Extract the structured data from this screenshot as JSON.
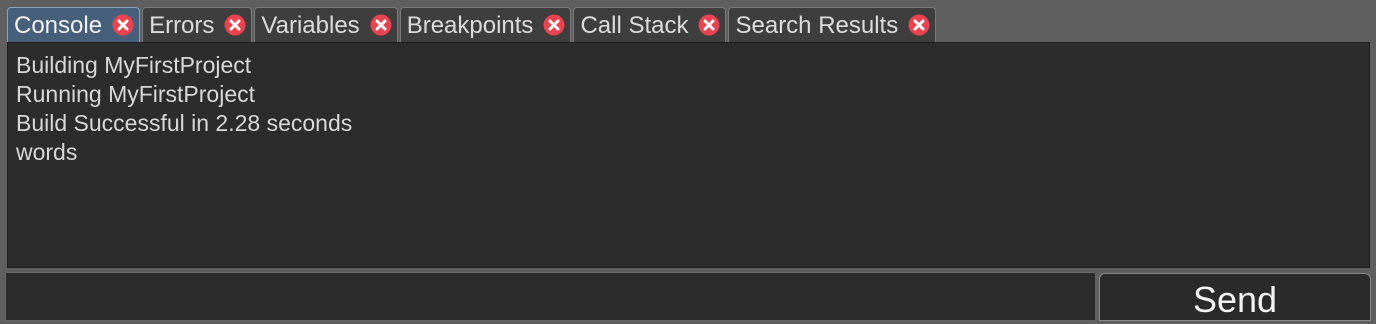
{
  "colors": {
    "close_icon_bg": "#e8434e",
    "close_icon_x": "#ffffff",
    "active_tab_bg": "#46607c",
    "panel_bg": "#2c2c2c"
  },
  "tabs": [
    {
      "label": "Console",
      "active": true,
      "icon": "close-icon"
    },
    {
      "label": "Errors",
      "active": false,
      "icon": "close-icon"
    },
    {
      "label": "Variables",
      "active": false,
      "icon": "close-icon"
    },
    {
      "label": "Breakpoints",
      "active": false,
      "icon": "close-icon"
    },
    {
      "label": "Call Stack",
      "active": false,
      "icon": "close-icon"
    },
    {
      "label": "Search Results",
      "active": false,
      "icon": "close-icon"
    }
  ],
  "console": {
    "lines": [
      "Building MyFirstProject",
      "Running MyFirstProject",
      "Build Successful in 2.28 seconds",
      "words"
    ]
  },
  "input": {
    "value": "",
    "placeholder": ""
  },
  "send_button": {
    "label": "Send"
  }
}
